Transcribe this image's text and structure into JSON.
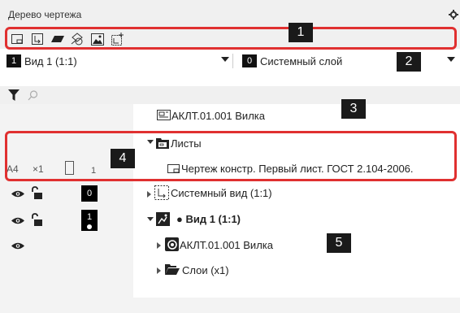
{
  "panel": {
    "title": "Дерево чертежа"
  },
  "icons": {
    "gear": "gear-icon",
    "toolbar": [
      "new-sheet-icon",
      "view-icon",
      "layer-icon",
      "geometry-icon",
      "image-icon",
      "insert-view-icon"
    ]
  },
  "dropdowns": {
    "view": {
      "number": "1",
      "label": "Вид 1 (1:1)"
    },
    "layer": {
      "number": "0",
      "label": "Системный слой"
    }
  },
  "search": {
    "placeholder": ""
  },
  "tree": {
    "document": "АКЛТ.01.001 Вилка",
    "sheets_folder": "Листы",
    "sheet": {
      "format": "A4",
      "multiplicity": "×1",
      "count": "1",
      "label": "Чертеж констр. Первый лист. ГОСТ 2.104-2006."
    },
    "system_view": {
      "number": "0",
      "label": "Системный вид (1:1)"
    },
    "view1": {
      "number": "1",
      "label": "● Вид 1 (1:1)"
    },
    "model": {
      "label": "АКЛТ.01.001 Вилка"
    },
    "layers": {
      "label": "Слои (x1)"
    }
  },
  "callouts": [
    "1",
    "2",
    "3",
    "4",
    "5"
  ],
  "colors": {
    "highlight": "#e03030",
    "callout_bg": "#1a1a1a",
    "panel_bg": "#f0f0f0"
  }
}
